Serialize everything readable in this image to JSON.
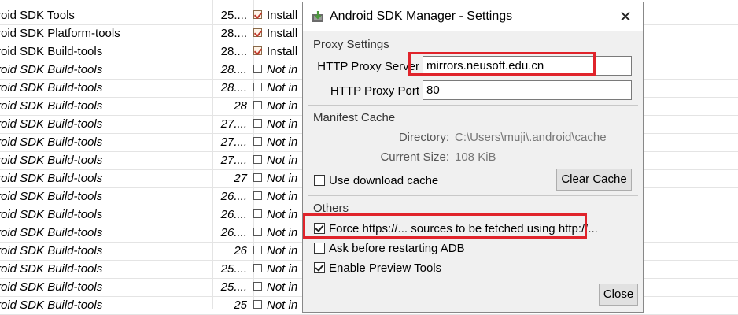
{
  "packages": [
    {
      "name": "roid SDK Tools",
      "rev": "25....",
      "status": "Install",
      "installed": true,
      "italic": false
    },
    {
      "name": "roid SDK Platform-tools",
      "rev": "28....",
      "status": "Install",
      "installed": true,
      "italic": false
    },
    {
      "name": "roid SDK Build-tools",
      "rev": "28....",
      "status": "Install",
      "installed": true,
      "italic": false
    },
    {
      "name": "roid SDK Build-tools",
      "rev": "28....",
      "status": "Not in",
      "installed": false,
      "italic": true
    },
    {
      "name": "roid SDK Build-tools",
      "rev": "28....",
      "status": "Not in",
      "installed": false,
      "italic": true
    },
    {
      "name": "roid SDK Build-tools",
      "rev": "28",
      "status": "Not in",
      "installed": false,
      "italic": true
    },
    {
      "name": "roid SDK Build-tools",
      "rev": "27....",
      "status": "Not in",
      "installed": false,
      "italic": true
    },
    {
      "name": "roid SDK Build-tools",
      "rev": "27....",
      "status": "Not in",
      "installed": false,
      "italic": true
    },
    {
      "name": "roid SDK Build-tools",
      "rev": "27....",
      "status": "Not in",
      "installed": false,
      "italic": true
    },
    {
      "name": "roid SDK Build-tools",
      "rev": "27",
      "status": "Not in",
      "installed": false,
      "italic": true
    },
    {
      "name": "roid SDK Build-tools",
      "rev": "26....",
      "status": "Not in",
      "installed": false,
      "italic": true
    },
    {
      "name": "roid SDK Build-tools",
      "rev": "26....",
      "status": "Not in",
      "installed": false,
      "italic": true
    },
    {
      "name": "roid SDK Build-tools",
      "rev": "26....",
      "status": "Not in",
      "installed": false,
      "italic": true
    },
    {
      "name": "roid SDK Build-tools",
      "rev": "26",
      "status": "Not in",
      "installed": false,
      "italic": true
    },
    {
      "name": "roid SDK Build-tools",
      "rev": "25....",
      "status": "Not in",
      "installed": false,
      "italic": true
    },
    {
      "name": "roid SDK Build-tools",
      "rev": "25....",
      "status": "Not in",
      "installed": false,
      "italic": true
    },
    {
      "name": "roid SDK Build-tools",
      "rev": "25",
      "status": "Not in",
      "installed": false,
      "italic": true
    }
  ],
  "dialog": {
    "title": "Android SDK Manager - Settings",
    "proxy": {
      "section_title": "Proxy Settings",
      "server_label": "HTTP Proxy Server",
      "server_value": "mirrors.neusoft.edu.cn",
      "port_label": "HTTP Proxy Port",
      "port_value": "80"
    },
    "manifest": {
      "section_title": "Manifest Cache",
      "directory_label": "Directory:",
      "directory_value": "C:\\Users\\muji\\.android\\cache",
      "size_label": "Current Size:",
      "size_value": "108 KiB",
      "use_cache_label": "Use download cache",
      "use_cache_checked": false,
      "clear_cache_label": "Clear Cache"
    },
    "others": {
      "section_title": "Others",
      "force_https_label": "Force https://... sources to be fetched using http://...",
      "force_https_checked": true,
      "ask_restart_label": "Ask before restarting ADB",
      "ask_restart_checked": false,
      "preview_tools_label": "Enable Preview Tools",
      "preview_tools_checked": true
    },
    "close_label": "Close"
  },
  "colors": {
    "highlight": "#e0242b",
    "dialog_bg": "#f0f0f0"
  }
}
